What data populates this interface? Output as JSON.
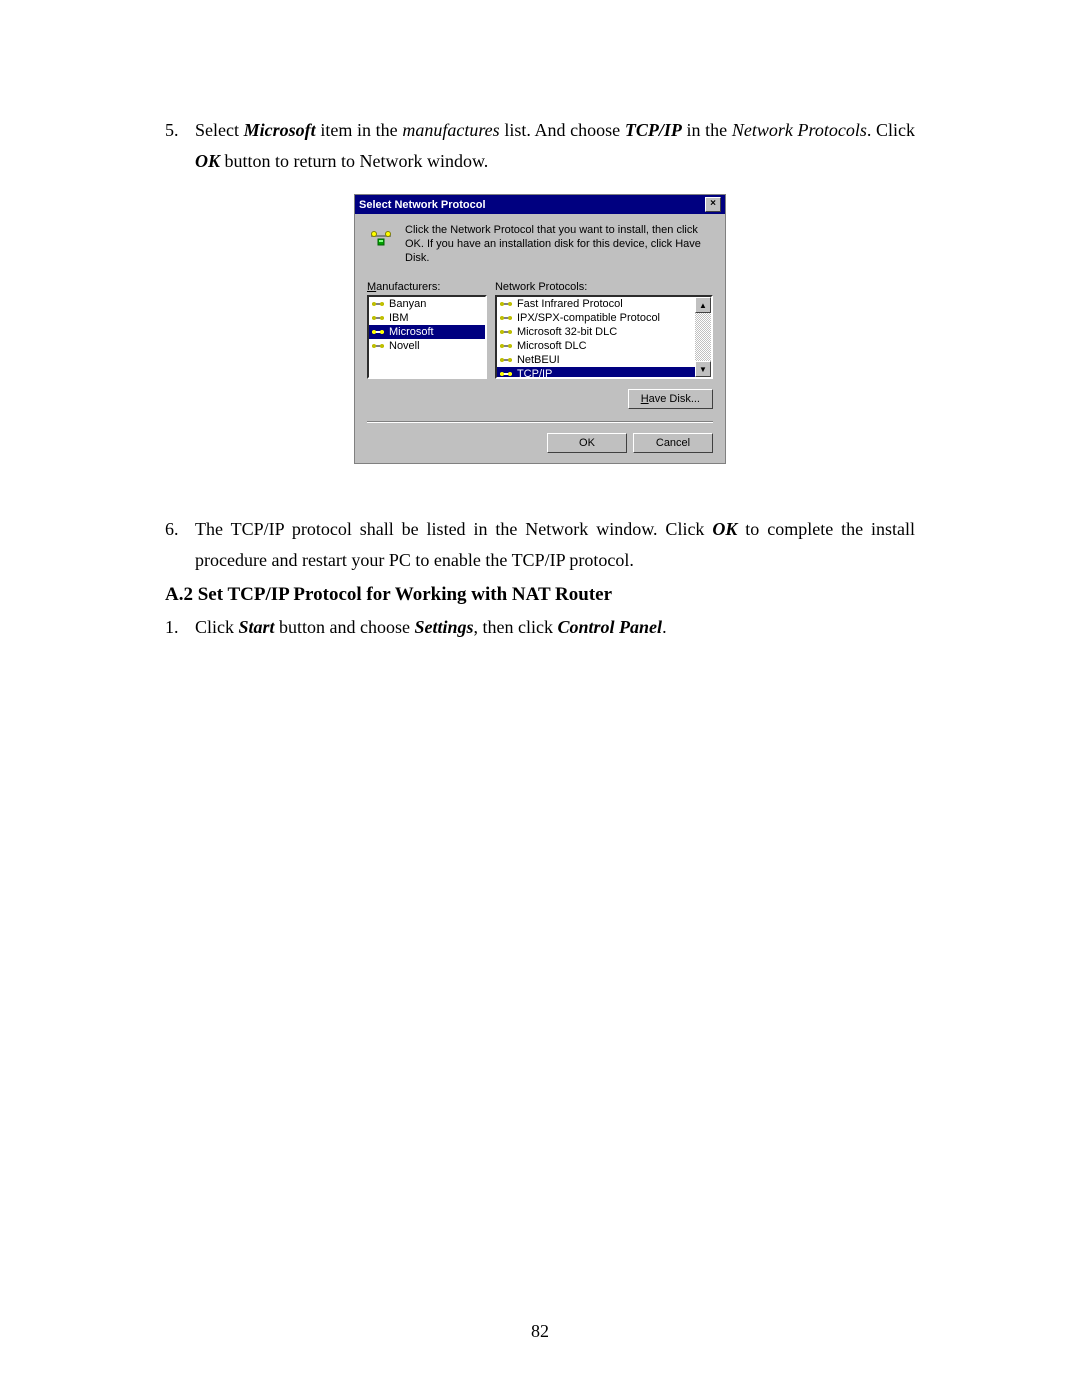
{
  "step5": {
    "num": "5.",
    "t1": "Select ",
    "bi1": "Microsoft",
    "t2": " item in the ",
    "i1": "manufactures",
    "t3": " list. And choose ",
    "bi2": "TCP/IP",
    "t4": " in the ",
    "i2": "Network Protocols",
    "t5": ". Click ",
    "bi3": "OK",
    "t6": " button to return to Network window."
  },
  "dialog": {
    "title": "Select Network Protocol",
    "close": "×",
    "instr": "Click the Network Protocol that you want to install, then click OK. If you have an installation disk for this device, click Have Disk.",
    "manu_label": "Manufacturers:",
    "proto_label": "Network Protocols:",
    "manufacturers": [
      "Banyan",
      "IBM",
      "Microsoft",
      "Novell"
    ],
    "manu_selected": 2,
    "protocols": [
      "Fast Infrared Protocol",
      "IPX/SPX-compatible Protocol",
      "Microsoft 32-bit DLC",
      "Microsoft DLC",
      "NetBEUI",
      "TCP/IP"
    ],
    "proto_selected": 5,
    "scroll_up": "▲",
    "scroll_down": "▼",
    "have_disk": "Have Disk...",
    "ok": "OK",
    "cancel": "Cancel"
  },
  "step6": {
    "num": "6.",
    "t1": "The TCP/IP protocol shall be listed in the Network window. Click ",
    "bi1": "OK",
    "t2": " to complete the install procedure and restart your PC to enable the TCP/IP protocol."
  },
  "heading": "A.2 Set TCP/IP Protocol for Working with NAT Router",
  "step1": {
    "num": "1.",
    "t1": "Click ",
    "bi1": "Start",
    "t2": " button and choose ",
    "bi2": "Settings",
    "t3": ", then click ",
    "bi3": "Control Panel",
    "t4": "."
  },
  "page_number": "82"
}
